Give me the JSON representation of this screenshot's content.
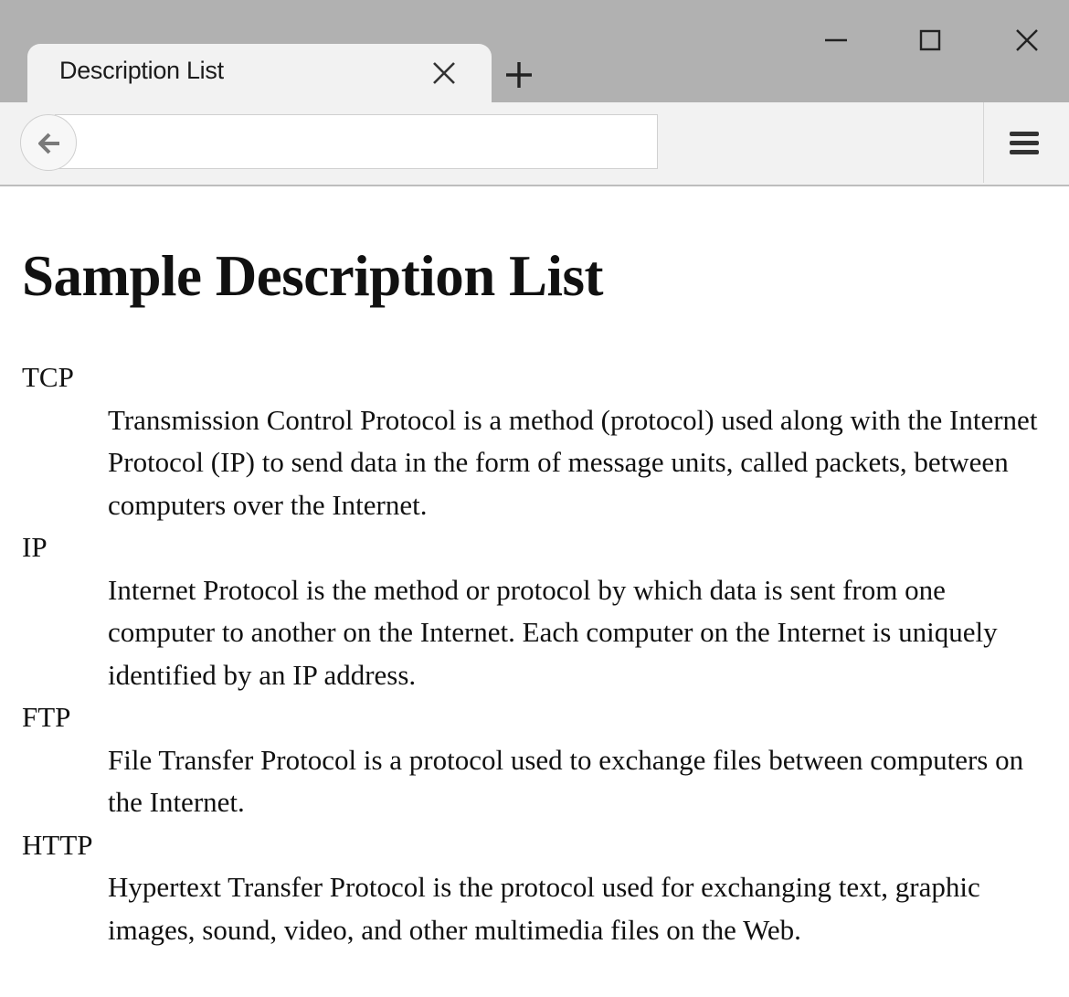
{
  "browser": {
    "tab_title": "Description List",
    "window_buttons": [
      "minimize-icon",
      "maximize-icon",
      "close-icon"
    ],
    "url_value": ""
  },
  "page": {
    "heading": "Sample Description List",
    "items": [
      {
        "term": "TCP",
        "description": "Transmission Control Protocol is a method (protocol) used along with the Internet Protocol (IP) to send data in the form of message units, called packets, between computers over the Internet."
      },
      {
        "term": "IP",
        "description": "Internet Protocol is the method or protocol by which data is sent from one computer to another on the Internet. Each computer on the Internet is uniquely identified by an IP address."
      },
      {
        "term": "FTP",
        "description": "File Transfer Protocol is a protocol used to exchange files between computers on the Internet."
      },
      {
        "term": "HTTP",
        "description": "Hypertext Transfer Protocol is the protocol used for exchanging text, graphic images, sound, video, and other multimedia files on the Web."
      }
    ]
  }
}
